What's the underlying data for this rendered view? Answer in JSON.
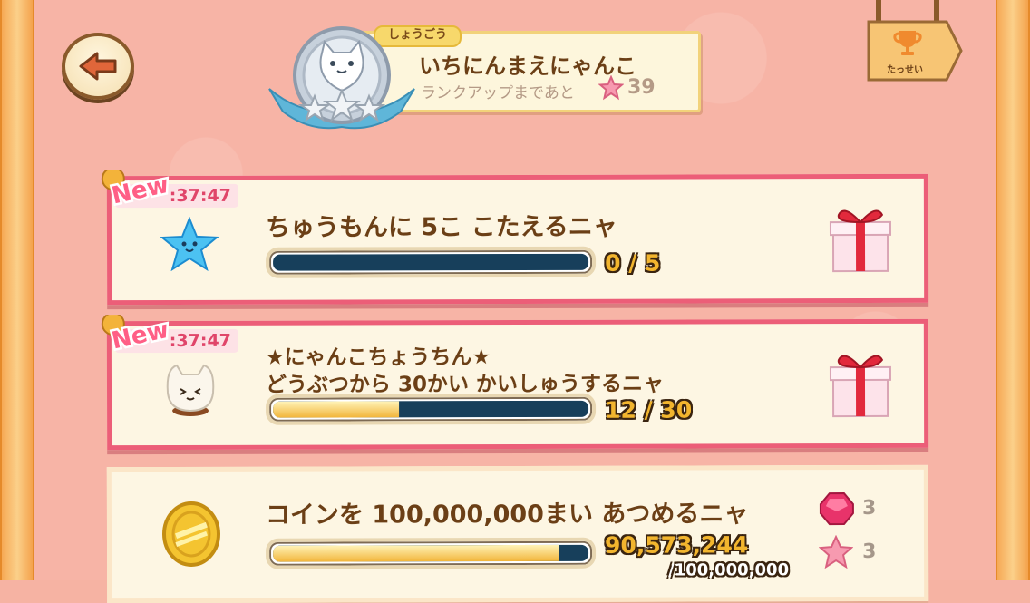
{
  "header": {
    "back_icon": "back-arrow-icon",
    "title_tag": "しょうごう",
    "title_name": "いちにんまえにゃんこ",
    "rank_up_text": "ランクアップまであと",
    "rank_up_remaining": "39",
    "achievements_label": "たっせい"
  },
  "missions": [
    {
      "badge": "New",
      "timer": ":37:47",
      "icon": "blue-star-icon",
      "title": "ちゅうもんに 5こ こたえるニャ",
      "subtitle": "",
      "progress_text": "0 / 5",
      "current": 0,
      "target": 5,
      "reward_icon": "gift-box-icon"
    },
    {
      "badge": "New",
      "timer": ":37:47",
      "icon": "cat-bun-icon",
      "title": "★にゃんこちょうちん★",
      "subtitle": "どうぶつから 30かい かいしゅうするニャ",
      "progress_text": "12 / 30",
      "current": 12,
      "target": 30,
      "reward_icon": "gift-box-icon"
    },
    {
      "icon": "gold-coin-icon",
      "title": "コインを 100,000,000まい あつめるニャ",
      "progress_current_text": "90,573,244",
      "progress_target_text": "/100,000,000",
      "current": 90573244,
      "target": 100000000,
      "rewards": [
        {
          "icon": "red-gem-icon",
          "count": "3"
        },
        {
          "icon": "pink-star-icon",
          "count": "3"
        }
      ]
    }
  ],
  "colors": {
    "background": "#f7b4a6",
    "card_border_active": "#ec5e78",
    "bar_track": "#173f5b",
    "bar_fill": "#f2b53a",
    "text_brown": "#6b3f16"
  }
}
